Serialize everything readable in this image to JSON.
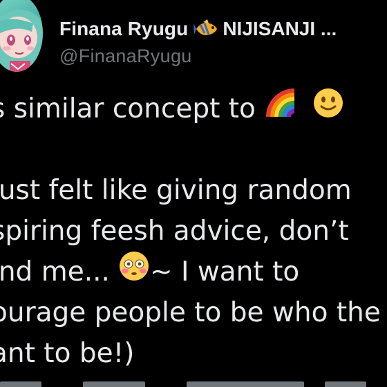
{
  "author": {
    "display_name": "Finana Ryugu",
    "org": "NIJISANJI ...",
    "handle": "@FinanaRyugu",
    "avatar_icon": "vtuber-avatar-icon",
    "badge_icon": "tropical-fish-icon"
  },
  "tweet": {
    "lines": [
      "s similar concept to",
      "",
      "just felt like giving random",
      "spiring feesh advice, don’t",
      "ind me...",
      "~ I want to",
      "ourage people to be who the",
      "ant to be!)"
    ],
    "emojis": [
      "rainbow-icon",
      "slightly-smiling-face-icon",
      "flushed-face-icon"
    ]
  },
  "colors": {
    "background": "#000000",
    "text": "#e7e9ea",
    "muted": "#71767b"
  }
}
